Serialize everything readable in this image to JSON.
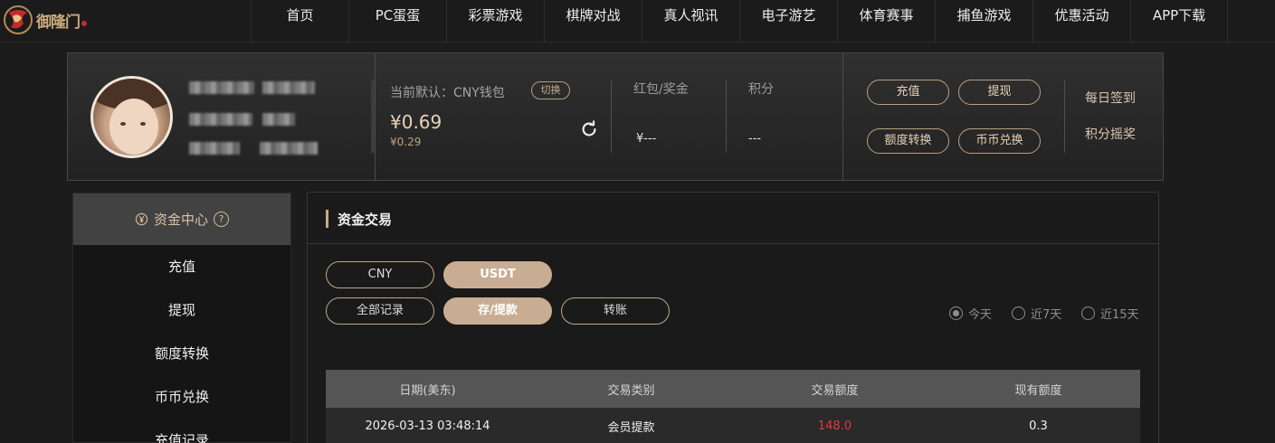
{
  "brand": {
    "name": "御隆门"
  },
  "nav": {
    "items": [
      "首页",
      "PC蛋蛋",
      "彩票游戏",
      "棋牌对战",
      "真人视讯",
      "电子游艺",
      "体育赛事",
      "捕鱼游戏",
      "优惠活动",
      "APP下载"
    ]
  },
  "account": {
    "wallet_label": "当前默认：CNY钱包",
    "switch_label": "切换",
    "balance": "¥0.69",
    "balance_sub": "¥0.29",
    "stats": [
      {
        "label": "红包/奖金",
        "value": "¥---"
      },
      {
        "label": "积分",
        "value": "---"
      }
    ],
    "actions": [
      "充值",
      "提现",
      "额度转换",
      "币币兑换"
    ],
    "side_links": [
      "每日签到",
      "积分摇奖"
    ]
  },
  "sidebar": {
    "title": "资金中心",
    "help_icon": "question-circle-icon",
    "items": [
      "充值",
      "提现",
      "额度转换",
      "币币兑换",
      "充值记录"
    ]
  },
  "main": {
    "title": "资金交易",
    "currency_tabs": [
      {
        "label": "CNY",
        "active": false
      },
      {
        "label": "USDT",
        "active": true
      }
    ],
    "record_tabs": [
      {
        "label": "全部记录",
        "active": false
      },
      {
        "label": "存/提款",
        "active": true
      },
      {
        "label": "转账",
        "active": false
      }
    ],
    "date_filters": [
      {
        "label": "今天",
        "checked": true
      },
      {
        "label": "近7天",
        "checked": false
      },
      {
        "label": "近15天",
        "checked": false
      }
    ],
    "table": {
      "headers": [
        "日期(美东)",
        "交易类别",
        "交易额度",
        "现有额度"
      ],
      "rows": [
        [
          "2026-03-13 03:48:14",
          "会员提款",
          "148.0",
          "0.3"
        ]
      ]
    }
  },
  "colors": {
    "accent": "#c9ad93",
    "negative": "#e13b3b",
    "background": "#1c1c1c"
  }
}
